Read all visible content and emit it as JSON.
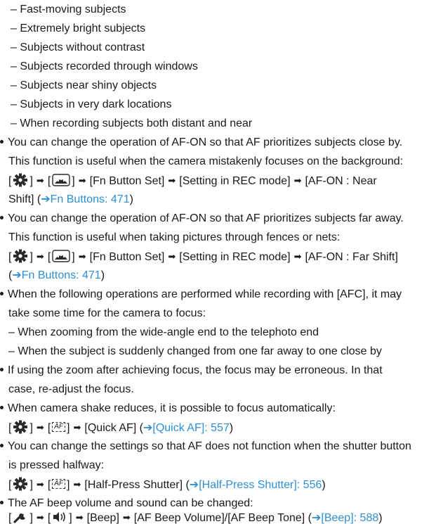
{
  "hard_subjects": [
    "– Fast-moving subjects",
    "– Extremely bright subjects",
    "– Subjects without contrast",
    "– Subjects recorded through windows",
    "– Subjects near shiny objects",
    "– Subjects in very dark locations",
    "– When recording subjects both distant and near"
  ],
  "near": {
    "line1": "You can change the operation of AF-ON so that AF prioritizes subjects close by.",
    "line2": "This function is useful when the camera mistakenly focuses on the background:",
    "menu": "[Fn Button Set]",
    "sub": "[Setting in REC mode]",
    "item_a": "[AF-ON : Near",
    "item_b": "Shift] (",
    "link": "Fn Buttons: 471",
    "close": ")"
  },
  "far": {
    "line1": "You can change the operation of AF-ON so that AF prioritizes subjects far away.",
    "line2": "This function is useful when taking pictures through fences or nets:",
    "menu": "[Fn Button Set]",
    "sub": "[Setting in REC mode]",
    "item": "[AF-ON : Far Shift]",
    "open": "(",
    "link": "Fn Buttons: 471",
    "close": ")"
  },
  "afc": {
    "line1": "When the following operations are performed while recording with [AFC], it may",
    "line2": "take some time for the camera to focus:",
    "d1": "– When zooming from the wide-angle end to the telephoto end",
    "d2": "– When the subject is suddenly changed from one far away to one close by"
  },
  "zoom": {
    "line1": "If using the zoom after achieving focus, the focus may be erroneous. In that",
    "line2": "case, re-adjust the focus."
  },
  "quick_af": {
    "line1": "When camera shake reduces, it is possible to focus automatically:",
    "item": "[Quick AF] (",
    "link": "[Quick AF]: 557",
    "close": ")"
  },
  "half_press": {
    "line1": "You can change the settings so that AF does not function when the shutter button",
    "line2": "is pressed halfway:",
    "item": "[Half-Press Shutter] (",
    "link": "[Half-Press Shutter]: 556",
    "close": ")"
  },
  "beep": {
    "line1": "The AF beep volume and sound can be changed:",
    "item1": "[Beep]",
    "item2": "[AF Beep Volume]/[AF Beep Tone] (",
    "link": "[Beep]: 588",
    "close": ")"
  },
  "icons": {
    "custom": "gear-icon",
    "operation": "camera-operation-icon",
    "af_tab": "af-tab-icon",
    "setup": "wrench-icon",
    "sound": "speaker-icon",
    "arrow": "➡",
    "link_arrow": "➔"
  },
  "af_label": "AF",
  "colors": {
    "link": "#2f8fd6",
    "text": "#1a1a1a"
  }
}
